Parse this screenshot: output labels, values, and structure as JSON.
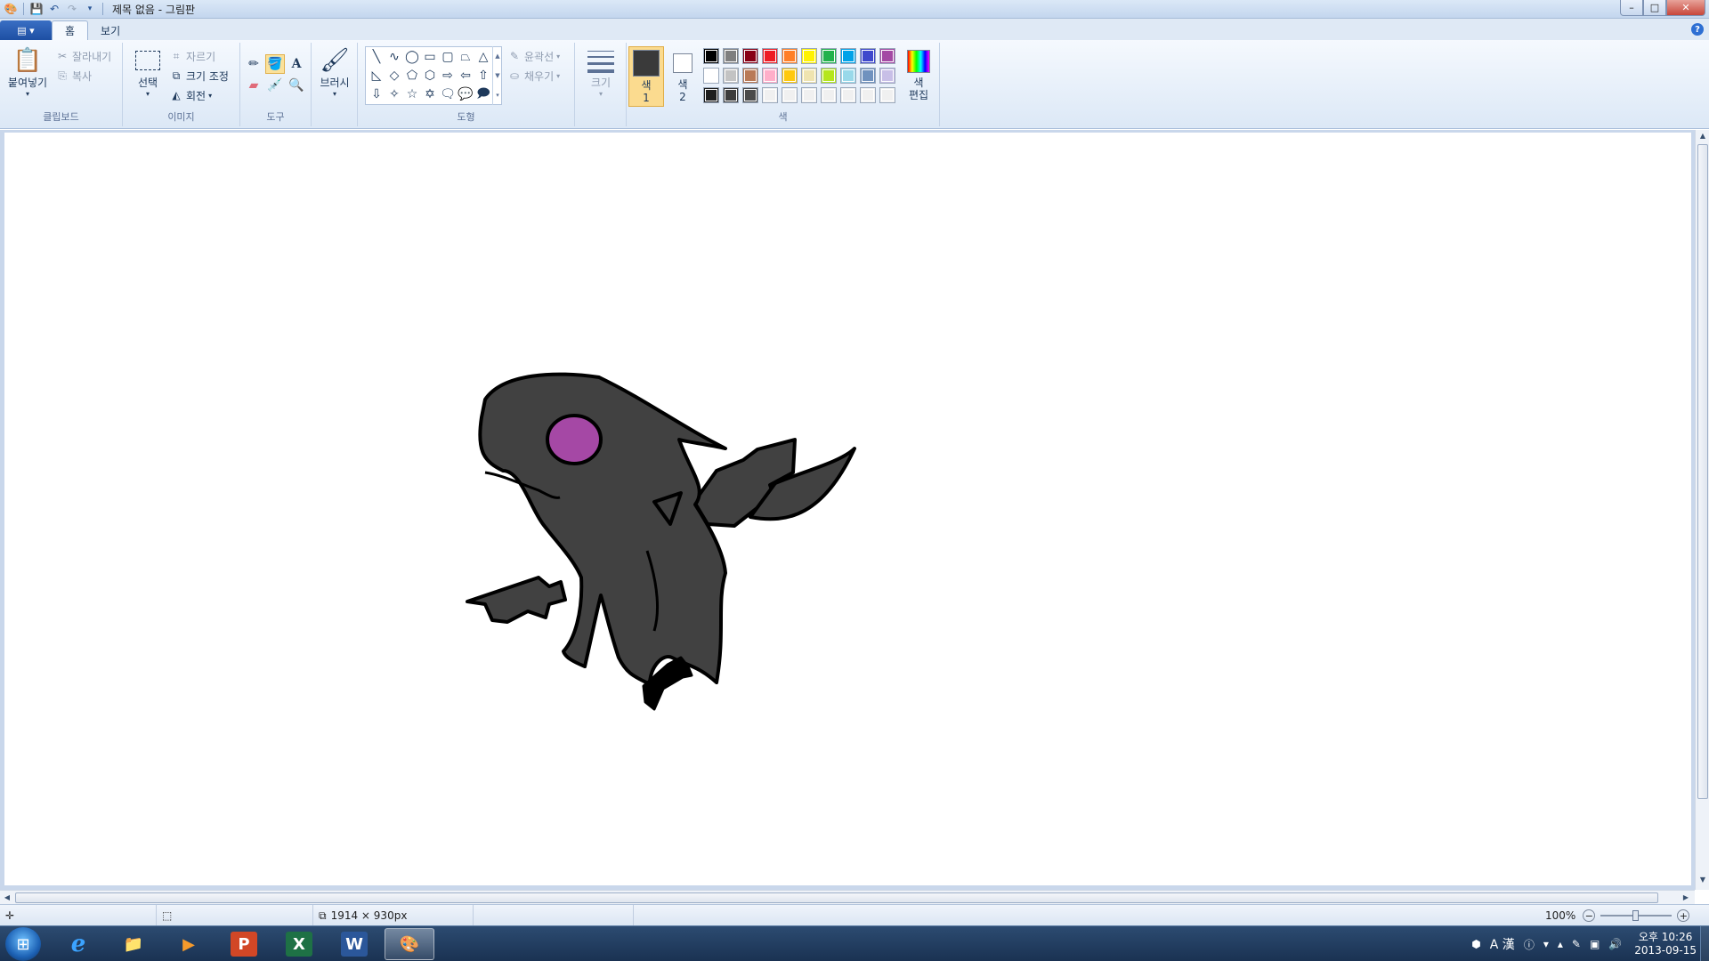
{
  "window": {
    "title": "제목 없음 - 그림판",
    "controls": {
      "minimize": "–",
      "maximize": "□",
      "close": "✕"
    }
  },
  "tabs": {
    "file": "▤ ▾",
    "home": "홈",
    "view": "보기",
    "help": "?"
  },
  "clipboard": {
    "paste": "붙여넣기",
    "cut": "잘라내기",
    "copy": "복사",
    "label": "클립보드"
  },
  "image": {
    "select": "선택",
    "crop": "자르기",
    "resize": "크기 조정",
    "rotate": "회전",
    "label": "이미지"
  },
  "tools": {
    "label": "도구",
    "brushes": "브러시"
  },
  "shapes": {
    "outline": "윤곽선",
    "fill": "채우기",
    "label": "도형"
  },
  "size": {
    "label": "크기"
  },
  "colors": {
    "color1_label": "색\n1",
    "color2_label": "색\n2",
    "edit_label": "색\n편집",
    "label": "색",
    "color1": "#3a3a3a",
    "color2": "#ffffff",
    "palette_row1": [
      "#000000",
      "#7f7f7f",
      "#880015",
      "#ed1c24",
      "#ff7f27",
      "#fff200",
      "#22b14c",
      "#00a2e8",
      "#3f48cc",
      "#a349a4"
    ],
    "palette_row2": [
      "#ffffff",
      "#c3c3c3",
      "#b97a57",
      "#ffaec9",
      "#ffc90e",
      "#efe4b0",
      "#b5e61d",
      "#99d9ea",
      "#7092be",
      "#c8bfe7"
    ],
    "palette_row3": [
      "#1e1e1e",
      "#3c3c3c",
      "#4a4a4a",
      "#f0f0f0",
      "#f0f0f0",
      "#f0f0f0",
      "#f0f0f0",
      "#f0f0f0",
      "#f0f0f0",
      "#f0f0f0"
    ]
  },
  "drawing": {
    "body_color": "#414141",
    "eye_color": "#a548a5"
  },
  "status": {
    "canvas_size": "1914 × 930px",
    "zoom": "100%"
  },
  "taskbar": {
    "apps": [
      "e",
      "📁",
      "▶",
      "P",
      "X",
      "W",
      "🎨"
    ],
    "tray_ime": "A 漢",
    "clock_time": "오후 10:26",
    "clock_date": "2013-09-15"
  }
}
